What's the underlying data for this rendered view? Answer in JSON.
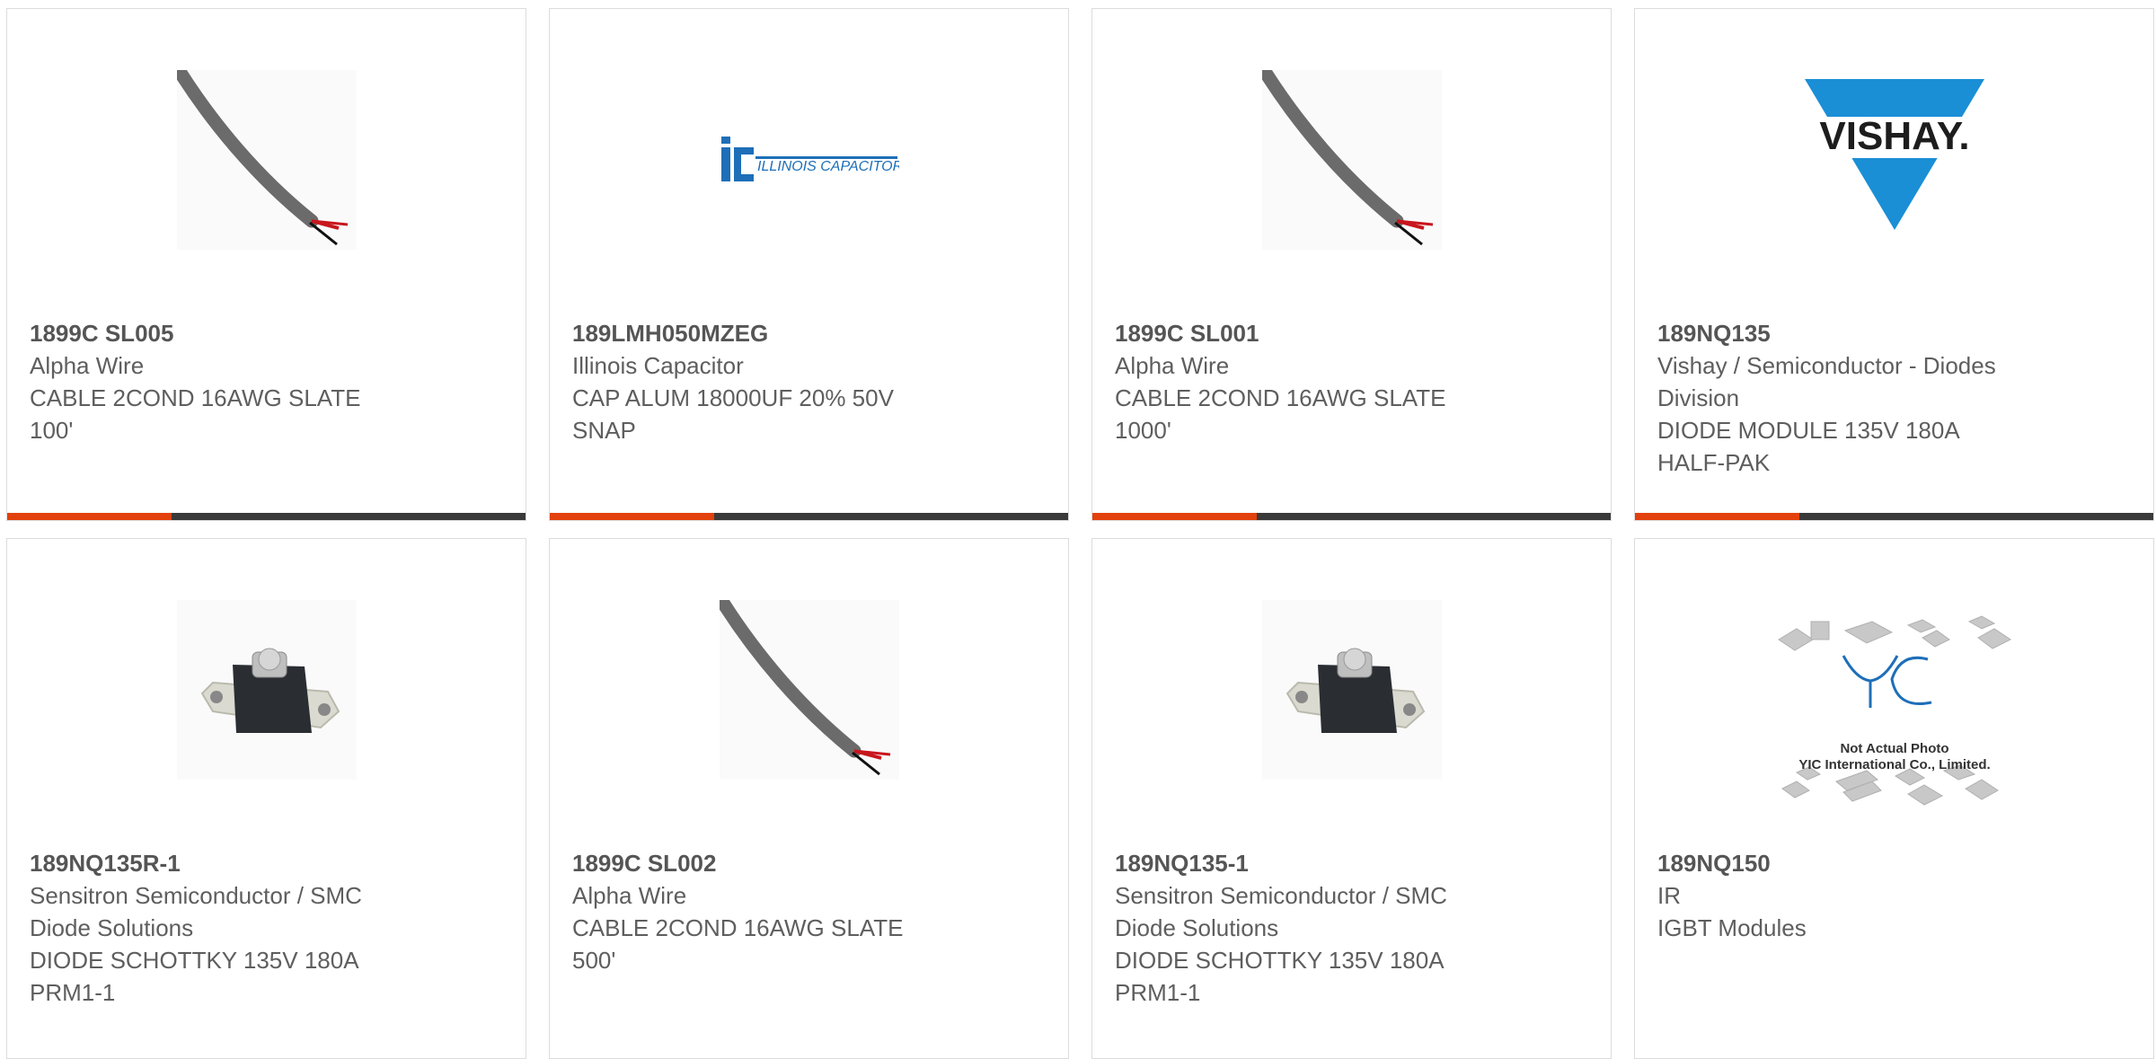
{
  "colors": {
    "accent": "#e2410d",
    "bar_dark": "#3a3a3a",
    "text": "#5e5e5e"
  },
  "products": [
    {
      "part": "1899C SL005",
      "maker": "Alpha Wire",
      "desc": "CABLE 2COND 16AWG SLATE\n100'",
      "image": "cable-icon"
    },
    {
      "part": "189LMH050MZEG",
      "maker": "Illinois Capacitor",
      "desc": "CAP ALUM 18000UF 20% 50V\nSNAP",
      "image": "illinois-capacitor-logo",
      "logo_text": "ILLINOIS CAPACITOR, INC."
    },
    {
      "part": "1899C SL001",
      "maker": "Alpha Wire",
      "desc": "CABLE 2COND 16AWG SLATE\n1000'",
      "image": "cable-icon"
    },
    {
      "part": "189NQ135",
      "maker": "Vishay / Semiconductor - Diodes\nDivision",
      "desc": "DIODE MODULE 135V 180A\nHALF-PAK",
      "image": "vishay-logo",
      "logo_text": "VISHAY."
    },
    {
      "part": "189NQ135R-1",
      "maker": "Sensitron Semiconductor / SMC\nDiode Solutions",
      "desc": "DIODE SCHOTTKY 135V 180A\nPRM1-1",
      "image": "diode-module-icon"
    },
    {
      "part": "1899C SL002",
      "maker": "Alpha Wire",
      "desc": "CABLE 2COND 16AWG SLATE\n500'",
      "image": "cable-icon"
    },
    {
      "part": "189NQ135-1",
      "maker": "Sensitron Semiconductor / SMC\nDiode Solutions",
      "desc": "DIODE SCHOTTKY 135V 180A\nPRM1-1",
      "image": "diode-module-icon"
    },
    {
      "part": "189NQ150",
      "maker": "IR",
      "desc": "IGBT Modules",
      "image": "not-actual-photo-icon",
      "logo_text": "YIC",
      "caption1": "Not Actual Photo",
      "caption2": "YIC International Co., Limited."
    }
  ]
}
